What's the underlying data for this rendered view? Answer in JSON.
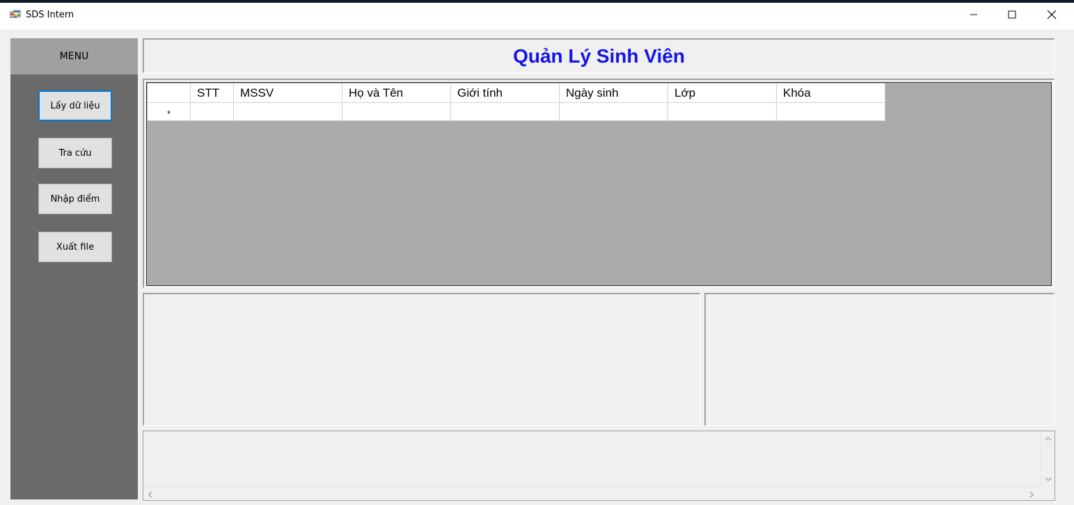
{
  "window": {
    "title": "SDS Intern"
  },
  "sidebar": {
    "menu_label": "MENU",
    "buttons": [
      {
        "label": "Lấy dữ liệu",
        "active": true
      },
      {
        "label": "Tra cứu",
        "active": false
      },
      {
        "label": "Nhập điểm",
        "active": false
      },
      {
        "label": "Xuất file",
        "active": false
      }
    ]
  },
  "header": {
    "title": "Quản Lý Sinh Viên",
    "title_color": "#1414e6"
  },
  "grid": {
    "columns": [
      "STT",
      "MSSV",
      "Họ và Tên",
      "Giới tính",
      "Ngày sinh",
      "Lớp",
      "Khóa"
    ],
    "new_row_marker": "*",
    "rows": []
  },
  "colors": {
    "sidebar_bg": "#6a6a6a",
    "menu_header_bg": "#a0a0a0",
    "grid_bg": "#ababab",
    "active_border": "#0078d7"
  }
}
